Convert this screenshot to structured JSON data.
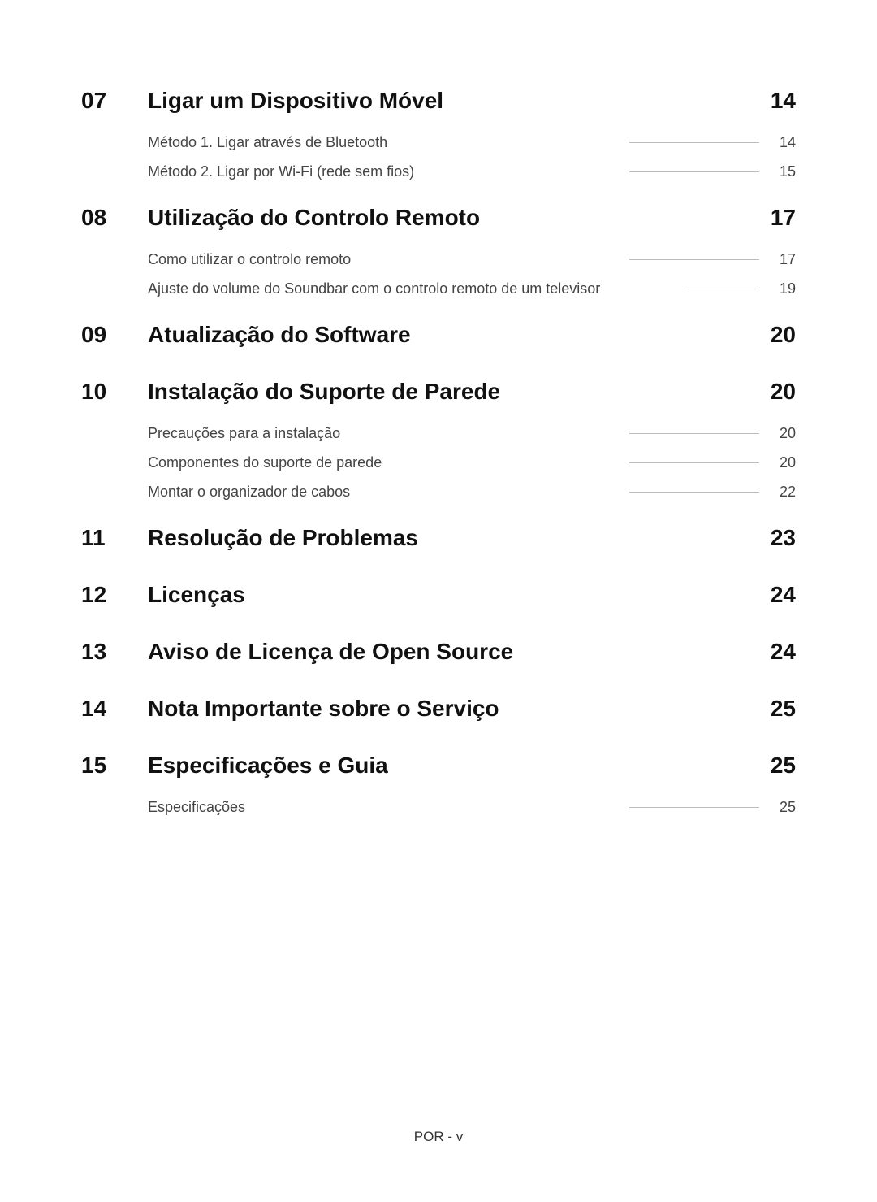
{
  "sections": [
    {
      "num": "07",
      "title": "Ligar um Dispositivo Móvel",
      "page": "14",
      "subs": [
        {
          "label": "Método 1. Ligar através de Bluetooth",
          "page": "14"
        },
        {
          "label": "Método 2. Ligar por Wi-Fi (rede sem fios)",
          "page": "15"
        }
      ]
    },
    {
      "num": "08",
      "title": "Utilização do Controlo Remoto",
      "page": "17",
      "subs": [
        {
          "label": "Como utilizar o controlo remoto",
          "page": "17"
        },
        {
          "label": "Ajuste do volume do Soundbar com o controlo remoto de um televisor",
          "page": "19"
        }
      ]
    },
    {
      "num": "09",
      "title": "Atualização do Software",
      "page": "20",
      "subs": []
    },
    {
      "num": "10",
      "title": "Instalação do Suporte de Parede",
      "page": "20",
      "subs": [
        {
          "label": "Precauções para a instalação",
          "page": "20"
        },
        {
          "label": "Componentes do suporte de parede",
          "page": "20"
        },
        {
          "label": "Montar o organizador de cabos",
          "page": "22"
        }
      ]
    },
    {
      "num": "11",
      "title": "Resolução de Problemas",
      "page": "23",
      "subs": []
    },
    {
      "num": "12",
      "title": "Licenças",
      "page": "24",
      "subs": []
    },
    {
      "num": "13",
      "title": "Aviso de Licença de Open Source",
      "page": "24",
      "subs": []
    },
    {
      "num": "14",
      "title": "Nota Importante sobre o Serviço",
      "page": "25",
      "subs": []
    },
    {
      "num": "15",
      "title": "Especificações e Guia",
      "page": "25",
      "subs": [
        {
          "label": "Especificações",
          "page": "25"
        }
      ]
    }
  ],
  "footer": "POR - v"
}
